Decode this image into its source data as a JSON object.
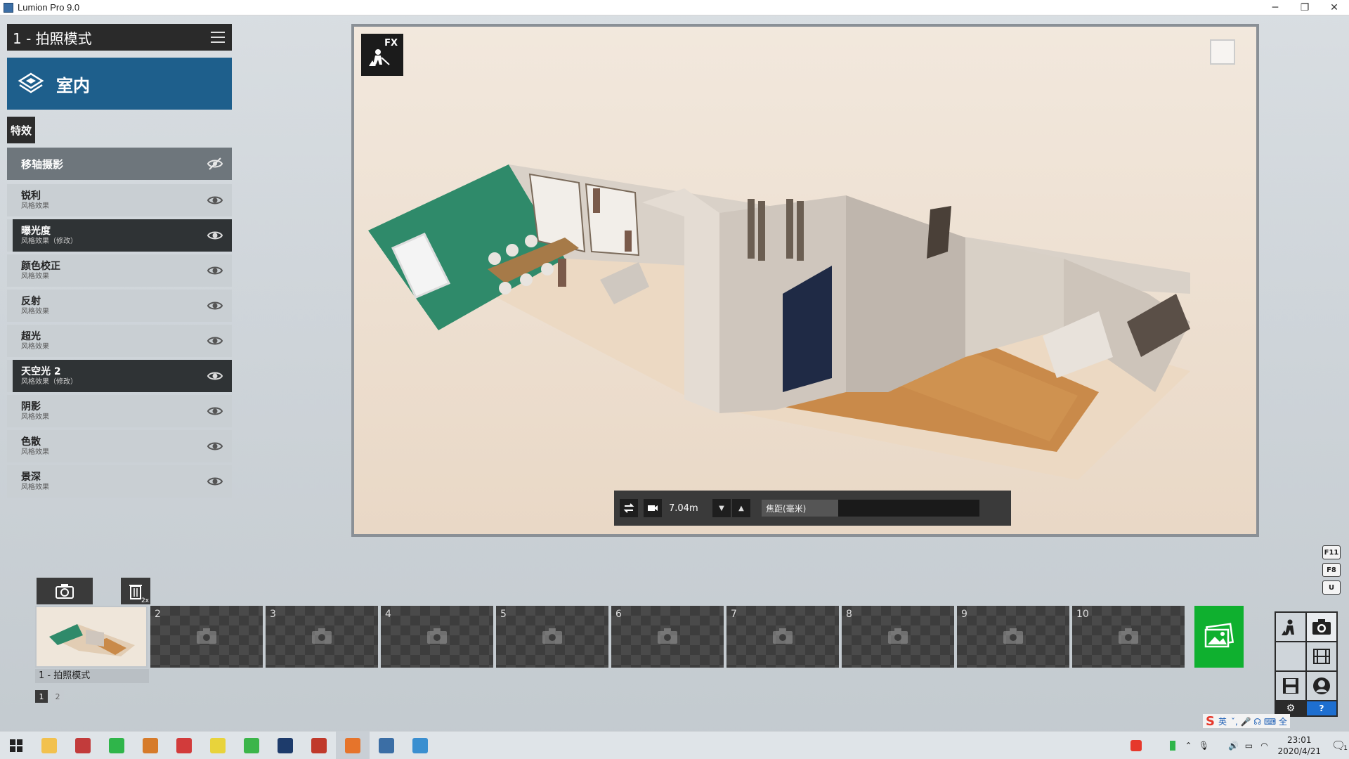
{
  "window": {
    "title": "Lumion Pro 9.0",
    "minimize": "─",
    "maximize": "❐",
    "close": "✕"
  },
  "mode_header": {
    "title": "1 - 拍照模式"
  },
  "scene_tile": {
    "label": "室内"
  },
  "fx_label": "特效",
  "tilt_shift": {
    "label": "移轴摄影"
  },
  "effects": [
    {
      "name": "锐利",
      "sub": "风格效果",
      "selected": false
    },
    {
      "name": "曝光度",
      "sub": "风格效果（修改）",
      "selected": true
    },
    {
      "name": "颜色校正",
      "sub": "风格效果",
      "selected": false
    },
    {
      "name": "反射",
      "sub": "风格效果",
      "selected": false
    },
    {
      "name": "超光",
      "sub": "风格效果",
      "selected": false
    },
    {
      "name": "天空光 2",
      "sub": "风格效果（修改）",
      "selected": true
    },
    {
      "name": "阴影",
      "sub": "风格效果",
      "selected": false
    },
    {
      "name": "色散",
      "sub": "风格效果",
      "selected": false
    },
    {
      "name": "景深",
      "sub": "风格效果",
      "selected": false
    }
  ],
  "viewport": {
    "fx_badge": "FX",
    "camera_height": "7.04m",
    "focal_label": "焦距(毫米)",
    "focal_fill": 0.35
  },
  "shortcut_keys": [
    "F11",
    "F8",
    "U"
  ],
  "photo_slots": {
    "first_caption": "1 - 拍照模式",
    "numbers": [
      "2",
      "3",
      "4",
      "5",
      "6",
      "7",
      "8",
      "9",
      "10"
    ],
    "delete_badge": "2x"
  },
  "pages": [
    "1",
    "2"
  ],
  "mode_panel": {
    "help": "?"
  },
  "ime": {
    "lang": "英",
    "extra": "ˇ, 🎤 ☊ ⌨ 全"
  },
  "taskbar": {
    "apps": [
      {
        "name": "file-explorer",
        "color": "#f2c14e"
      },
      {
        "name": "app-red-grid",
        "color": "#c23b3b"
      },
      {
        "name": "app-green",
        "color": "#2fb54a"
      },
      {
        "name": "app-orange",
        "color": "#d67b2a"
      },
      {
        "name": "app-red",
        "color": "#d23b3b"
      },
      {
        "name": "player",
        "color": "#e8d33b"
      },
      {
        "name": "wechat",
        "color": "#3bb54a"
      },
      {
        "name": "photoshop",
        "color": "#1d3b6b"
      },
      {
        "name": "app-pdf",
        "color": "#c0392b"
      },
      {
        "name": "lumion",
        "color": "#e6742b"
      },
      {
        "name": "app-cad",
        "color": "#3b6ea5"
      },
      {
        "name": "app-remote",
        "color": "#3a8fd0"
      }
    ],
    "time": "23:01",
    "date": "2020/4/21",
    "notify_count": "1"
  }
}
